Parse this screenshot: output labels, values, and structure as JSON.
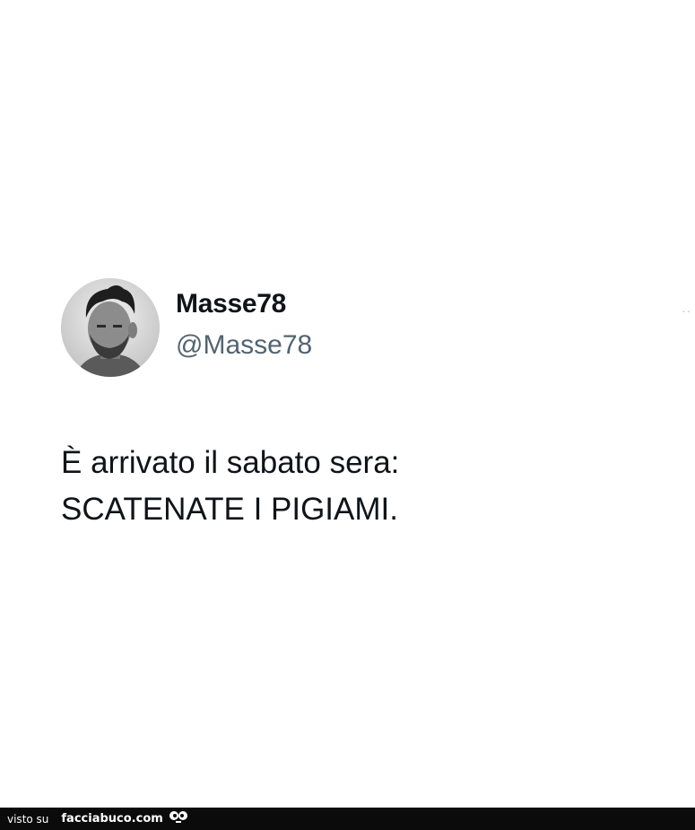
{
  "tweet": {
    "display_name": "Masse78",
    "handle": "@Masse78",
    "text": "È arrivato il sabato sera:\nSCATENATE I PIGIAMI.",
    "more_label": "··"
  },
  "footer": {
    "prefix": "visto su",
    "site": "facciabuco.com"
  },
  "colors": {
    "name": "#0f1419",
    "handle": "#536471",
    "footer_bg": "#0b0b0b"
  }
}
